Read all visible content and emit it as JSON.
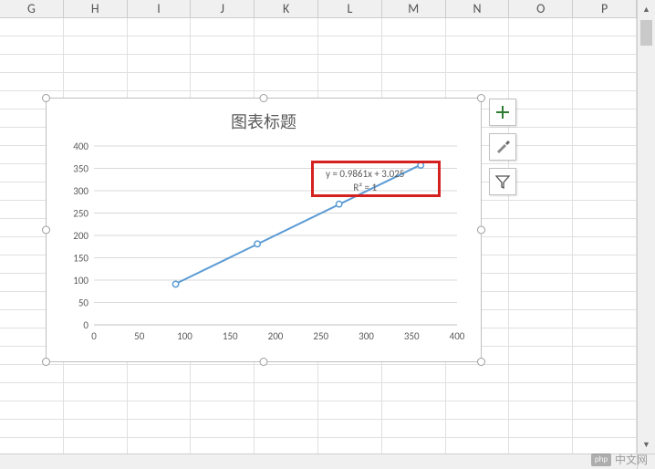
{
  "spreadsheet": {
    "columns": [
      "G",
      "H",
      "I",
      "J",
      "K",
      "L",
      "M",
      "N",
      "O",
      "P"
    ]
  },
  "chart_data": {
    "type": "scatter",
    "title": "图表标题",
    "x": [
      90,
      180,
      270,
      360
    ],
    "y": [
      91,
      181,
      270,
      357
    ],
    "trendline_equation": "y = 0.9861x + 3.025",
    "r_squared": "R² = 1",
    "xlim": [
      0,
      400
    ],
    "ylim": [
      0,
      400
    ],
    "x_ticks": [
      0,
      50,
      100,
      150,
      200,
      250,
      300,
      350,
      400
    ],
    "y_ticks": [
      0,
      50,
      100,
      150,
      200,
      250,
      300,
      350,
      400
    ],
    "xlabel": "",
    "ylabel": "",
    "series_color": "#5b9bd5"
  },
  "side_buttons": {
    "add": "chart-elements-plus",
    "style": "chart-style-brush",
    "filter": "chart-filter-funnel"
  },
  "watermark": {
    "logo": "php",
    "text": "中文网"
  }
}
